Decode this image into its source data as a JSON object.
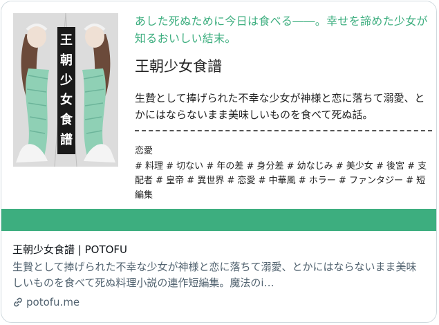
{
  "preview": {
    "cover_title_chars": [
      "王",
      "朝",
      "少",
      "女",
      "食",
      "譜"
    ],
    "tagline": "あした死ぬために今日は食べる――。幸せを諦めた少女が知るおいしい結末。",
    "book_title": "王朝少女食譜",
    "synopsis": "生贄として捧げられた不幸な少女が神様と恋に落ちて溺愛、とかにはならないまま美味しいものを食べて死ぬ話。",
    "genre": "恋愛",
    "tags": "# 料理 # 切ない # 年の差 # 身分差 # 幼なじみ # 美少女 # 後宮 # 支配者 # 皇帝 # 異世界 # 恋愛 # 中華風 # ホラー # ファンタジー # 短編集",
    "accent_color": "#3dae7f"
  },
  "link_card": {
    "title": "王朝少女食譜 | POTOFU",
    "description": "生贄として捧げられた不幸な少女が神様と恋に落ちて溺愛、とかにはならないまま美味しいものを食べて死ぬ料理小説の連作短編集。魔法のi…",
    "domain": "potofu.me",
    "domain_icon": "link-icon"
  }
}
